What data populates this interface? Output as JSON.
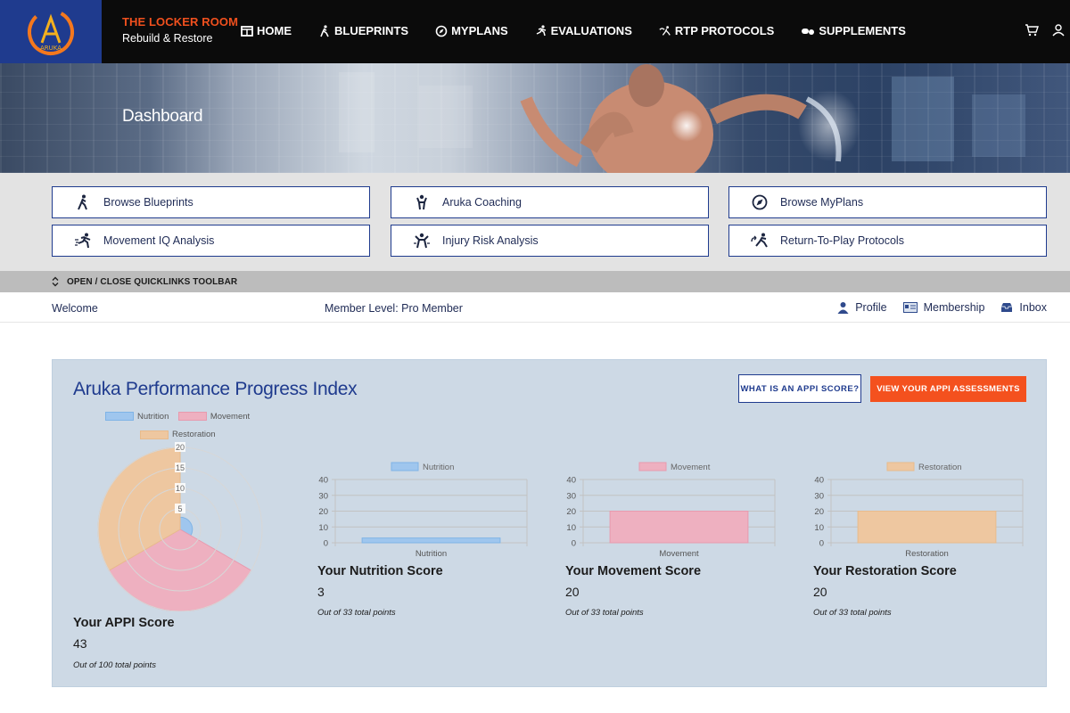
{
  "brand": {
    "logo_text": "ARUKA",
    "title": "THE LOCKER ROOM",
    "subtitle": "Rebuild & Restore"
  },
  "nav": [
    {
      "label": "HOME",
      "icon": "home-icon"
    },
    {
      "label": "BLUEPRINTS",
      "icon": "walk-icon"
    },
    {
      "label": "MYPLANS",
      "icon": "compass-icon"
    },
    {
      "label": "EVALUATIONS",
      "icon": "run-icon"
    },
    {
      "label": "RTP PROTOCOLS",
      "icon": "return-icon"
    },
    {
      "label": "SUPPLEMENTS",
      "icon": "pills-icon"
    }
  ],
  "hero": {
    "title": "Dashboard"
  },
  "quicklinks": [
    {
      "label": "Browse Blueprints",
      "icon": "walk-icon"
    },
    {
      "label": "Aruka Coaching",
      "icon": "coach-icon"
    },
    {
      "label": "Browse MyPlans",
      "icon": "compass-icon"
    },
    {
      "label": "Movement IQ Analysis",
      "icon": "sprint-icon"
    },
    {
      "label": "Injury Risk Analysis",
      "icon": "body-icon"
    },
    {
      "label": "Return-To-Play Protocols",
      "icon": "return-icon"
    }
  ],
  "toolbar_label": "OPEN / CLOSE QUICKLINKS TOOLBAR",
  "welcome": "Welcome",
  "member_level": "Member Level: Pro Member",
  "user_links": [
    {
      "label": "Profile",
      "icon": "person-icon"
    },
    {
      "label": "Membership",
      "icon": "card-icon"
    },
    {
      "label": "Inbox",
      "icon": "inbox-icon"
    }
  ],
  "appi": {
    "title": "Aruka Performance Progress Index",
    "what_button": "WHAT IS AN APPI SCORE?",
    "view_button": "VIEW YOUR APPI ASSESSMENTS",
    "score_title": "Your APPI Score",
    "score_value": "43",
    "score_note": "Out of 100 total points"
  },
  "colors": {
    "nutrition": "#7fb4e6",
    "movement": "#e89aae",
    "restoration": "#e8bb8c",
    "accent": "#f4511e",
    "navy": "#1f3b8e"
  },
  "chart_data": [
    {
      "type": "polar-area",
      "series": [
        {
          "name": "Nutrition",
          "value": 3
        },
        {
          "name": "Movement",
          "value": 20
        },
        {
          "name": "Restoration",
          "value": 20
        }
      ],
      "ticks": [
        "5",
        "10",
        "15",
        "20"
      ],
      "rlim": [
        0,
        20
      ]
    },
    {
      "type": "bar",
      "categories": [
        "Nutrition"
      ],
      "series": [
        {
          "name": "Nutrition",
          "values": [
            3
          ]
        }
      ],
      "yticks": [
        "0",
        "10",
        "20",
        "30",
        "40"
      ],
      "ylim": [
        0,
        40
      ],
      "score_title": "Your Nutrition Score",
      "score_value": "3",
      "score_note": "Out of 33 total points"
    },
    {
      "type": "bar",
      "categories": [
        "Movement"
      ],
      "series": [
        {
          "name": "Movement",
          "values": [
            20
          ]
        }
      ],
      "yticks": [
        "0",
        "10",
        "20",
        "30",
        "40"
      ],
      "ylim": [
        0,
        40
      ],
      "score_title": "Your Movement Score",
      "score_value": "20",
      "score_note": "Out of 33 total points"
    },
    {
      "type": "bar",
      "categories": [
        "Restoration"
      ],
      "series": [
        {
          "name": "Restoration",
          "values": [
            20
          ]
        }
      ],
      "yticks": [
        "0",
        "10",
        "20",
        "30",
        "40"
      ],
      "ylim": [
        0,
        40
      ],
      "score_title": "Your Restoration Score",
      "score_value": "20",
      "score_note": "Out of 33 total points"
    }
  ]
}
